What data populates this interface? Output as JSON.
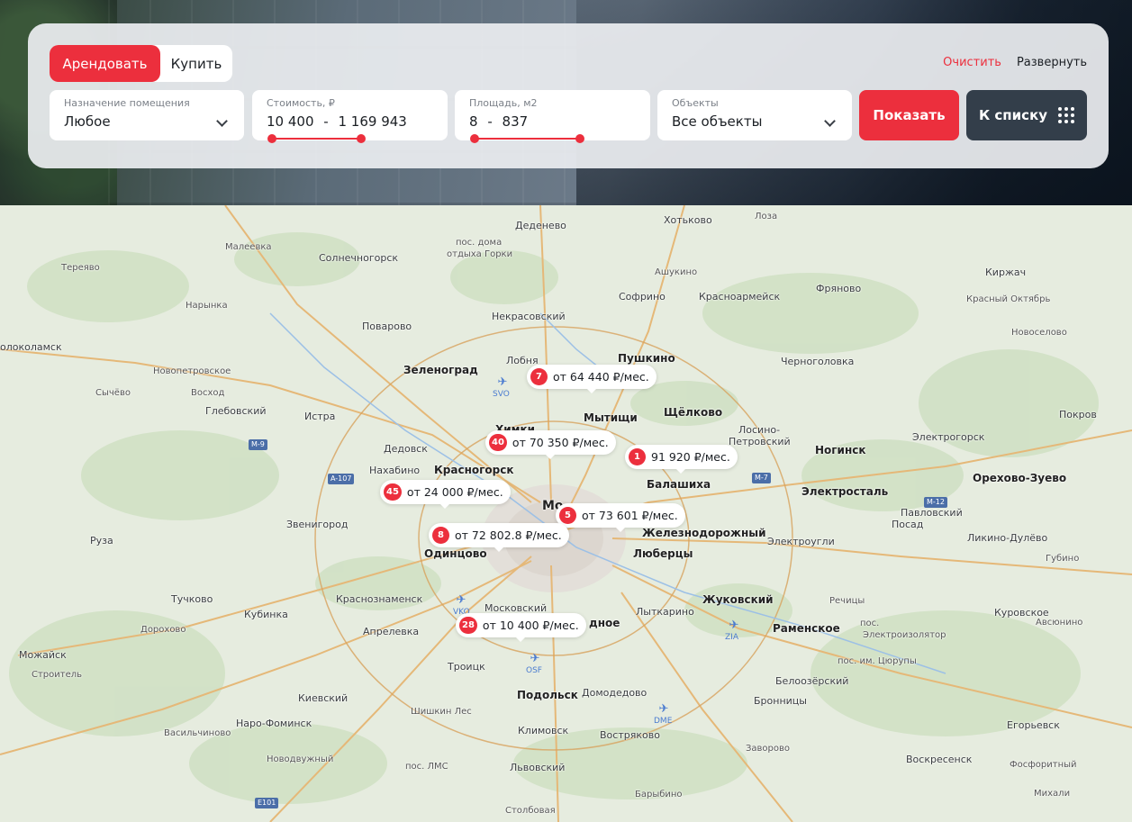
{
  "filter": {
    "deal_tabs": [
      {
        "label": "Арендовать",
        "active": true
      },
      {
        "label": "Купить",
        "active": false
      }
    ],
    "clear_label": "Очистить",
    "expand_label": "Развернуть",
    "purpose": {
      "label": "Назначение помещения",
      "value": "Любое"
    },
    "price": {
      "label": "Стоимость, ₽",
      "min": "10 400",
      "max": "1 169 943",
      "separator": "-"
    },
    "area": {
      "label": "Площадь, м2",
      "min": "8",
      "max": "837",
      "separator": "-"
    },
    "objects": {
      "label": "Объекты",
      "value": "Все объекты"
    },
    "show_button": "Показать",
    "list_button": "К списку",
    "accent_color": "#ec2f3d",
    "dark_button_color": "#333e4a"
  },
  "map": {
    "places": [
      {
        "name": "Деденево",
        "cls": ""
      },
      {
        "name": "Хотьково",
        "cls": ""
      },
      {
        "name": "Лоза",
        "cls": "small"
      },
      {
        "name": "Малеевка",
        "cls": "small"
      },
      {
        "name": "пос. дома",
        "cls": "small"
      },
      {
        "name": "отдыха Горки",
        "cls": "small"
      },
      {
        "name": "Солнечногорск",
        "cls": ""
      },
      {
        "name": "Тереяво",
        "cls": "small"
      },
      {
        "name": "Ашукино",
        "cls": "small"
      },
      {
        "name": "Киржач",
        "cls": ""
      },
      {
        "name": "Красный Октябрь",
        "cls": "small"
      },
      {
        "name": "Фряново",
        "cls": ""
      },
      {
        "name": "Софрино",
        "cls": ""
      },
      {
        "name": "Красноармейск",
        "cls": ""
      },
      {
        "name": "Нарынка",
        "cls": "small"
      },
      {
        "name": "Некрасовский",
        "cls": ""
      },
      {
        "name": "Поварово",
        "cls": ""
      },
      {
        "name": "Новоселово",
        "cls": "small"
      },
      {
        "name": "Пушкино",
        "cls": "big"
      },
      {
        "name": "Лобня",
        "cls": ""
      },
      {
        "name": "олоколамск",
        "cls": ""
      },
      {
        "name": "Черноголовка",
        "cls": ""
      },
      {
        "name": "Зеленоград",
        "cls": "big"
      },
      {
        "name": "Новопетровское",
        "cls": "small"
      },
      {
        "name": "Сычёво",
        "cls": "small"
      },
      {
        "name": "Восход",
        "cls": "small"
      },
      {
        "name": "Глебовский",
        "cls": ""
      },
      {
        "name": "Истра",
        "cls": ""
      },
      {
        "name": "Химки",
        "cls": "big"
      },
      {
        "name": "Мытищи",
        "cls": "big"
      },
      {
        "name": "Щёлково",
        "cls": "big"
      },
      {
        "name": "Лосино-",
        "cls": ""
      },
      {
        "name": "Петровский",
        "cls": ""
      },
      {
        "name": "Электрогорск",
        "cls": ""
      },
      {
        "name": "Покров",
        "cls": ""
      },
      {
        "name": "Дедовск",
        "cls": ""
      },
      {
        "name": "Ногинск",
        "cls": "big"
      },
      {
        "name": "Нахабино",
        "cls": ""
      },
      {
        "name": "Красногорск",
        "cls": "big"
      },
      {
        "name": "Балашиха",
        "cls": "big"
      },
      {
        "name": "Орехово-Зуево",
        "cls": "big"
      },
      {
        "name": "Электросталь",
        "cls": "big"
      },
      {
        "name": "Павловский",
        "cls": ""
      },
      {
        "name": "Посад",
        "cls": ""
      },
      {
        "name": "Звенигород",
        "cls": ""
      },
      {
        "name": "Железнодорожный",
        "cls": "big"
      },
      {
        "name": "Электроугли",
        "cls": ""
      },
      {
        "name": "Ликино-Дулёво",
        "cls": ""
      },
      {
        "name": "Руза",
        "cls": ""
      },
      {
        "name": "Одинцово",
        "cls": "big"
      },
      {
        "name": "Люберцы",
        "cls": "big"
      },
      {
        "name": "Губино",
        "cls": "small"
      },
      {
        "name": "Тучково",
        "cls": ""
      },
      {
        "name": "Краснознаменск",
        "cls": ""
      },
      {
        "name": "Жуковский",
        "cls": "big"
      },
      {
        "name": "Речицы",
        "cls": "small"
      },
      {
        "name": "Кубинка",
        "cls": ""
      },
      {
        "name": "Московский",
        "cls": ""
      },
      {
        "name": "Лыткарино",
        "cls": ""
      },
      {
        "name": "Куровское",
        "cls": ""
      },
      {
        "name": "Дорохово",
        "cls": "small"
      },
      {
        "name": "Апрелевка",
        "cls": ""
      },
      {
        "name": "Раменское",
        "cls": "big"
      },
      {
        "name": "пос.",
        "cls": "small"
      },
      {
        "name": "Электроизолятор",
        "cls": "small"
      },
      {
        "name": "Авсюнино",
        "cls": "small"
      },
      {
        "name": "Можайск",
        "cls": ""
      },
      {
        "name": "Троицк",
        "cls": ""
      },
      {
        "name": "пос. им. Цюрупы",
        "cls": "small"
      },
      {
        "name": "Строитель",
        "cls": "small"
      },
      {
        "name": "Белоозёрский",
        "cls": ""
      },
      {
        "name": "Киевский",
        "cls": ""
      },
      {
        "name": "Подольск",
        "cls": "big"
      },
      {
        "name": "Домодедово",
        "cls": ""
      },
      {
        "name": "Бронницы",
        "cls": ""
      },
      {
        "name": "Шишкин Лес",
        "cls": "small"
      },
      {
        "name": "Наро-Фоминск",
        "cls": ""
      },
      {
        "name": "Васильчиново",
        "cls": "small"
      },
      {
        "name": "Климовск",
        "cls": ""
      },
      {
        "name": "Егорьевск",
        "cls": ""
      },
      {
        "name": "Востряково",
        "cls": ""
      },
      {
        "name": "Заворово",
        "cls": "small"
      },
      {
        "name": "Новодвужный",
        "cls": "small"
      },
      {
        "name": "пос. ЛМС",
        "cls": "small"
      },
      {
        "name": "Воскресенск",
        "cls": ""
      },
      {
        "name": "Фосфоритный",
        "cls": "small"
      },
      {
        "name": "Львовский",
        "cls": ""
      },
      {
        "name": "Барыбино",
        "cls": "small"
      },
      {
        "name": "Михали",
        "cls": "small"
      },
      {
        "name": "Столбовая",
        "cls": "small"
      },
      {
        "name": "Мо",
        "cls": "big"
      },
      {
        "name": "дное",
        "cls": "big"
      }
    ],
    "airports": [
      {
        "code": "SVO"
      },
      {
        "code": "VKO"
      },
      {
        "code": "OSF"
      },
      {
        "code": "DME"
      },
      {
        "code": "ZIA"
      }
    ],
    "highways": [
      "M-9",
      "A-107",
      "M-7",
      "M-12",
      "E101"
    ],
    "pins": [
      {
        "count": "7",
        "text": "от 64 440 ₽/мес."
      },
      {
        "count": "40",
        "text": "от 70 350 ₽/мес."
      },
      {
        "count": "1",
        "text": "91 920 ₽/мес."
      },
      {
        "count": "45",
        "text": "от 24 000 ₽/мес."
      },
      {
        "count": "5",
        "text": "от 73 601 ₽/мес."
      },
      {
        "count": "8",
        "text": "от 72 802.8 ₽/мес."
      },
      {
        "count": "28",
        "text": "от 10 400 ₽/мес."
      }
    ]
  }
}
